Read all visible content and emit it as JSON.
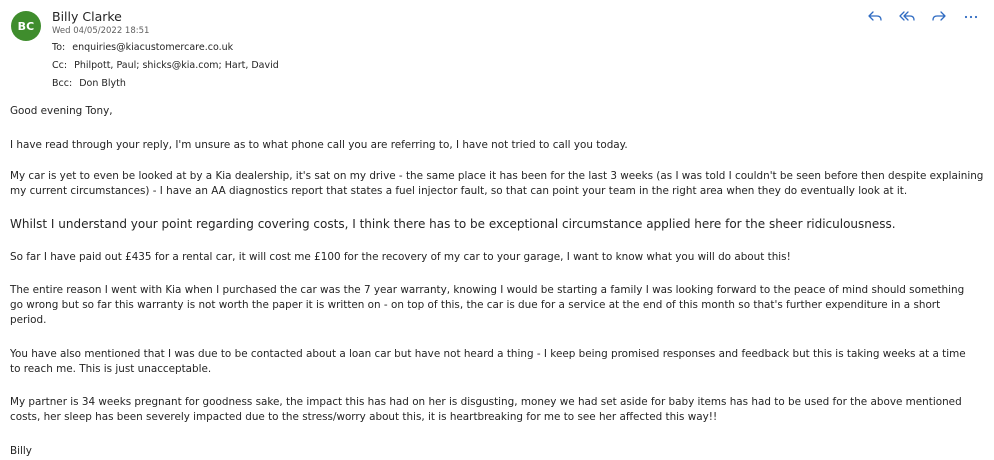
{
  "sender": {
    "initials": "BC",
    "name": "Billy Clarke",
    "date": "Wed 04/05/2022 18:51"
  },
  "recipients": {
    "to_label": "To:",
    "to": "enquiries@kiacustomercare.co.uk",
    "cc_label": "Cc:",
    "cc": "Philpott, Paul;  shicks@kia.com;  Hart, David",
    "bcc_label": "Bcc:",
    "bcc": "Don Blyth"
  },
  "actions": {
    "icons": [
      "reply-icon",
      "reply-all-icon",
      "forward-icon",
      "more-icon"
    ]
  },
  "body": {
    "greeting": "Good evening Tony,",
    "p1": "I have read through your reply, I'm unsure as to what phone call you are referring to, I have not tried to call you today.",
    "p2_l1": "My car is yet to even be looked at by a Kia dealership, it's sat on my drive - the same place it has been for the last 3 weeks (as I was told I couldn't be seen before then despite explaining",
    "p2_l2": "my current circumstances) - I have an AA diagnostics report that states a fuel injector fault, so that can point your team in the right area when they do eventually look at it.",
    "p3": "Whilst I understand your point regarding covering costs, I think there has to be exceptional circumstance applied here for the sheer ridiculousness.",
    "p4": "So far I have paid out £435 for a rental car, it will cost me £100 for the recovery of my car to your garage, I want to know what you will do about this!",
    "p5_l1": "The entire reason I went with Kia when I purchased the car was the 7 year warranty, knowing I would be starting a family I was looking forward to the peace of mind should something",
    "p5_l2": "go wrong but so far this warranty is not worth the paper it is written on - on top of this, the car is due for a service at the end of this month so that's further expenditure in a short",
    "p5_l3": "period.",
    "p6_l1": "You have also mentioned that I was due to be contacted about a loan car but have not heard a thing - I keep being promised responses and feedback but this is taking weeks at a time",
    "p6_l2": "to reach me. This is just unacceptable.",
    "p7_l1": "My partner is 34 weeks pregnant for goodness sake, the impact this has had on her is disgusting, money we had set aside for baby items has had to be used for the above mentioned",
    "p7_l2": "costs, her sleep has been severely impacted due to the stress/worry about this, it is heartbreaking for me to see her affected this way!!",
    "signoff": "Billy"
  },
  "colors": {
    "avatar": "#3f8d2d",
    "action_icon": "#2f6bc2",
    "text": "#242424",
    "muted": "#616161"
  }
}
